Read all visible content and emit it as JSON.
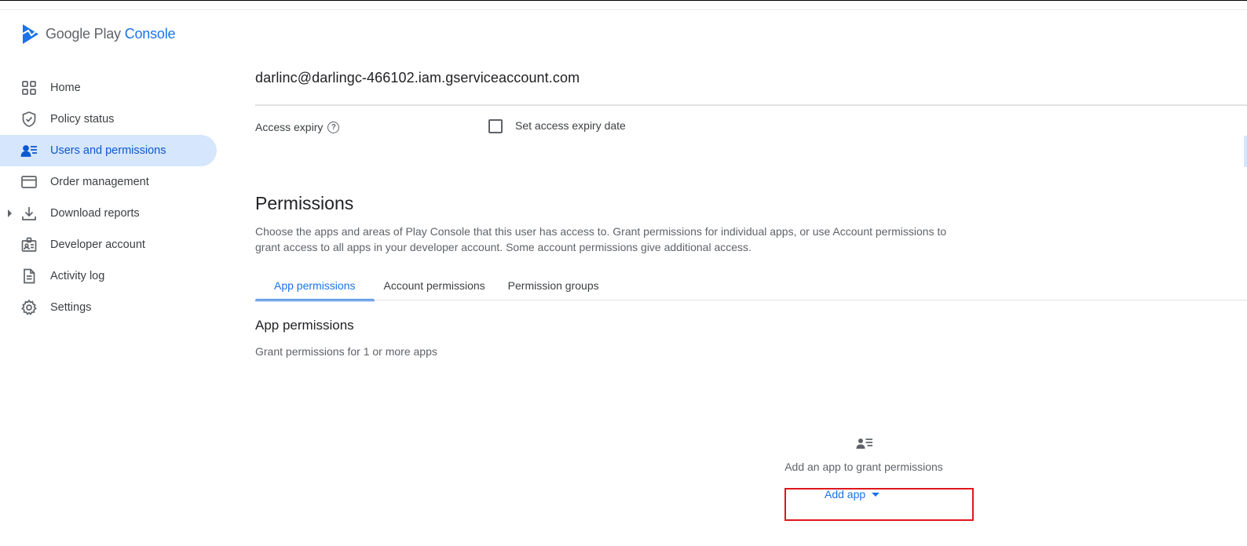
{
  "logo": {
    "part1": "Google Play",
    "part2": "Console"
  },
  "sidebar": {
    "items": [
      {
        "label": "Home",
        "icon": "home-grid-icon"
      },
      {
        "label": "Policy status",
        "icon": "shield-check-icon"
      },
      {
        "label": "Users and permissions",
        "icon": "users-permissions-icon",
        "active": true
      },
      {
        "label": "Order management",
        "icon": "credit-card-icon"
      },
      {
        "label": "Download reports",
        "icon": "download-icon",
        "expandable": true
      },
      {
        "label": "Developer account",
        "icon": "badge-icon"
      },
      {
        "label": "Activity log",
        "icon": "document-icon"
      },
      {
        "label": "Settings",
        "icon": "gear-icon"
      }
    ]
  },
  "user": {
    "email": "darlinc@darlingc-466102.iam.gserviceaccount.com"
  },
  "access": {
    "label": "Access expiry",
    "checkbox_label": "Set access expiry date",
    "checked": false
  },
  "permissions": {
    "title": "Permissions",
    "description": "Choose the apps and areas of Play Console that this user has access to. Grant permissions for individual apps, or use Account permissions to grant access to all apps in your developer account. Some account permissions give additional access.",
    "tabs": [
      "App permissions",
      "Account permissions",
      "Permission groups"
    ],
    "active_tab": "App permissions"
  },
  "app_permissions": {
    "title": "App permissions",
    "subtitle": "Grant permissions for 1 or more apps",
    "empty_text": "Add an app to grant permissions",
    "add_button": "Add app"
  },
  "colors": {
    "accent": "#1a73e8",
    "active_bg": "#d6e6fc",
    "highlight": "#e0161b"
  }
}
